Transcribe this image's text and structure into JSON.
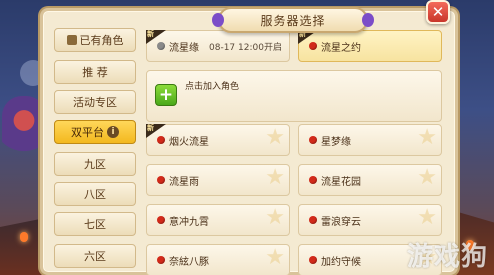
{
  "window": {
    "title": "服务器选择",
    "close_symbol": "✕"
  },
  "sidebar": {
    "items": [
      {
        "label": "已有角色",
        "icon": "user-icon",
        "active": false
      },
      {
        "label": "推 荐",
        "active": false
      },
      {
        "label": "活动专区",
        "active": false
      },
      {
        "label": "双平台",
        "icon": "info-icon",
        "active": true
      },
      {
        "label": "九区",
        "active": false
      },
      {
        "label": "八区",
        "active": false
      },
      {
        "label": "七区",
        "active": false
      },
      {
        "label": "六区",
        "active": false
      }
    ],
    "info_symbol": "i"
  },
  "recent": [
    {
      "name": "流星缘",
      "status": "grey",
      "badge": "新",
      "date": "08-17  12:00开启"
    },
    {
      "name": "流星之约",
      "status": "red",
      "badge": "新",
      "selected": true
    }
  ],
  "add_role": {
    "label": "点击加入角色",
    "plus_symbol": "+"
  },
  "servers": [
    {
      "name": "烟火流星",
      "status": "red",
      "badge": "新"
    },
    {
      "name": "星梦缘",
      "status": "red"
    },
    {
      "name": "流星雨",
      "status": "red"
    },
    {
      "name": "流星花园",
      "status": "red"
    },
    {
      "name": "意冲九霄",
      "status": "red"
    },
    {
      "name": "雷浪穿云",
      "status": "red"
    },
    {
      "name": "奈絃八豚",
      "status": "red"
    },
    {
      "name": "加约守候",
      "status": "red"
    }
  ],
  "watermark": "游戏狗",
  "colors": {
    "active_tab": "#f3b81e",
    "status_red": "#d22a1a",
    "status_grey": "#8a8a8a",
    "add_button": "#4aa81a",
    "close_button": "#c8362a"
  }
}
